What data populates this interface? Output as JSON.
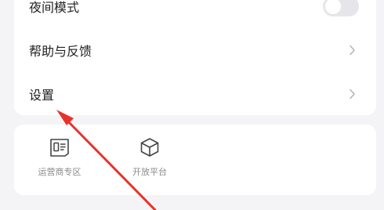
{
  "settings": {
    "night_mode_label": "夜间模式",
    "help_feedback_label": "帮助与反馈",
    "settings_label": "设置"
  },
  "tools": [
    {
      "label": "运营商专区",
      "icon": "carrier-card-icon"
    },
    {
      "label": "开放平台",
      "icon": "cube-icon"
    }
  ],
  "colors": {
    "background": "#f4f4f6",
    "card": "#ffffff",
    "arrow": "#e8322b",
    "chevron": "#b0b0b0",
    "tool_label": "#8a8a8a"
  }
}
